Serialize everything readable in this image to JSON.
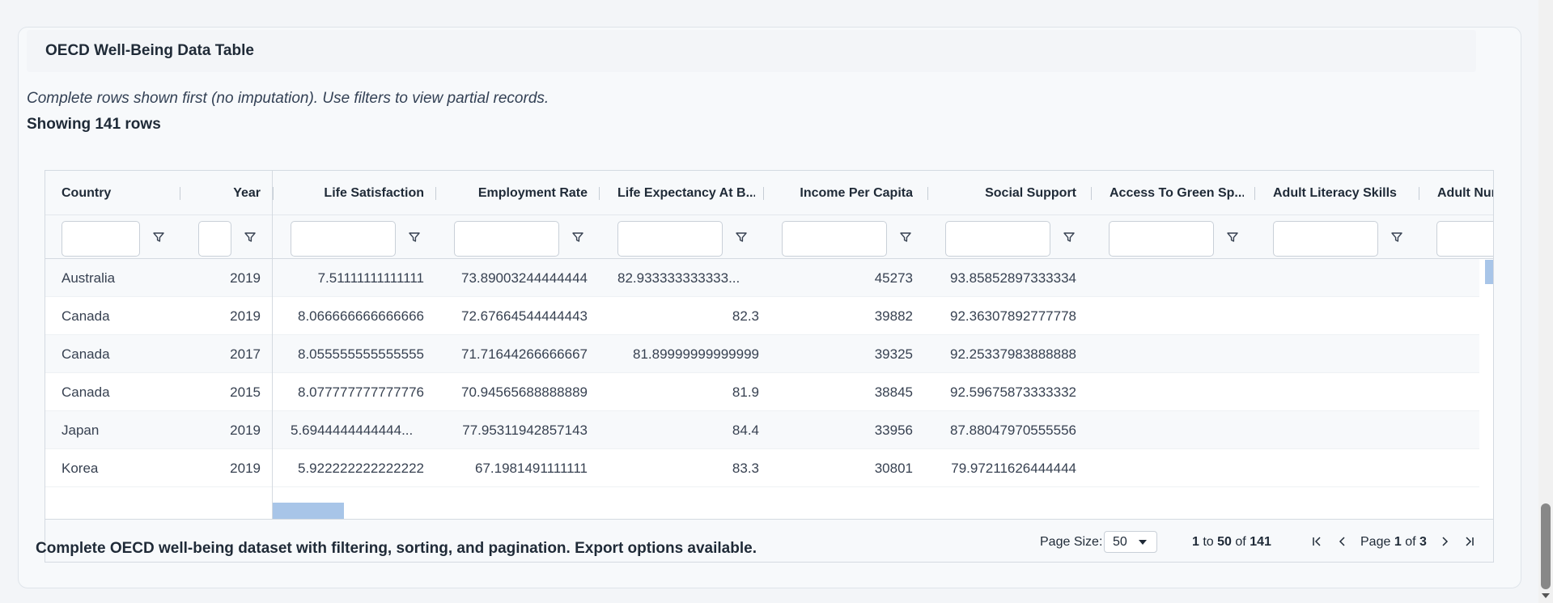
{
  "panel": {
    "title": "OECD Well-Being Data Table",
    "subtitle": "Complete rows shown first (no imputation). Use filters to view partial records.",
    "row_count_text": "Showing 141 rows",
    "footer_note": "Complete OECD well-being dataset with filtering, sorting, and pagination. Export options available."
  },
  "grid": {
    "columns": [
      {
        "label": "Country",
        "align": "left"
      },
      {
        "label": "Year",
        "align": "right"
      },
      {
        "label": "Life Satisfaction",
        "align": "right"
      },
      {
        "label": "Employment Rate",
        "align": "right"
      },
      {
        "label": "Life Expectancy At B...",
        "align": "left"
      },
      {
        "label": "Income Per Capita",
        "align": "right"
      },
      {
        "label": "Social Support",
        "align": "right"
      },
      {
        "label": "Access To Green Sp...",
        "align": "left"
      },
      {
        "label": "Adult Literacy Skills",
        "align": "left"
      },
      {
        "label": "Adult Num",
        "align": "left"
      }
    ],
    "rows": [
      [
        "Australia",
        "2019",
        "7.51111111111111",
        "73.89003244444444",
        "82.933333333333...",
        "45273",
        "93.85852897333334"
      ],
      [
        "Canada",
        "2019",
        "8.066666666666666",
        "72.67664544444443",
        "82.3",
        "39882",
        "92.36307892777778"
      ],
      [
        "Canada",
        "2017",
        "8.055555555555555",
        "71.71644266666667",
        "81.89999999999999",
        "39325",
        "92.25337983888888"
      ],
      [
        "Canada",
        "2015",
        "8.077777777777776",
        "70.94565688888889",
        "81.9",
        "38845",
        "92.59675873333332"
      ],
      [
        "Japan",
        "2019",
        "5.6944444444444...",
        "77.95311942857143",
        "84.4",
        "33956",
        "87.88047970555556"
      ],
      [
        "Korea",
        "2019",
        "5.922222222222222",
        "67.1981491111111",
        "83.3",
        "30801",
        "79.97211626444444"
      ]
    ]
  },
  "pagination": {
    "page_size_label": "Page Size:",
    "page_size_value": "50",
    "range_from": "1",
    "range_to_word": "to",
    "range_to": "50",
    "range_of_word": "of",
    "range_total": "141",
    "page_word": "Page",
    "page_current": "1",
    "page_of_word": "of",
    "page_total": "3"
  }
}
